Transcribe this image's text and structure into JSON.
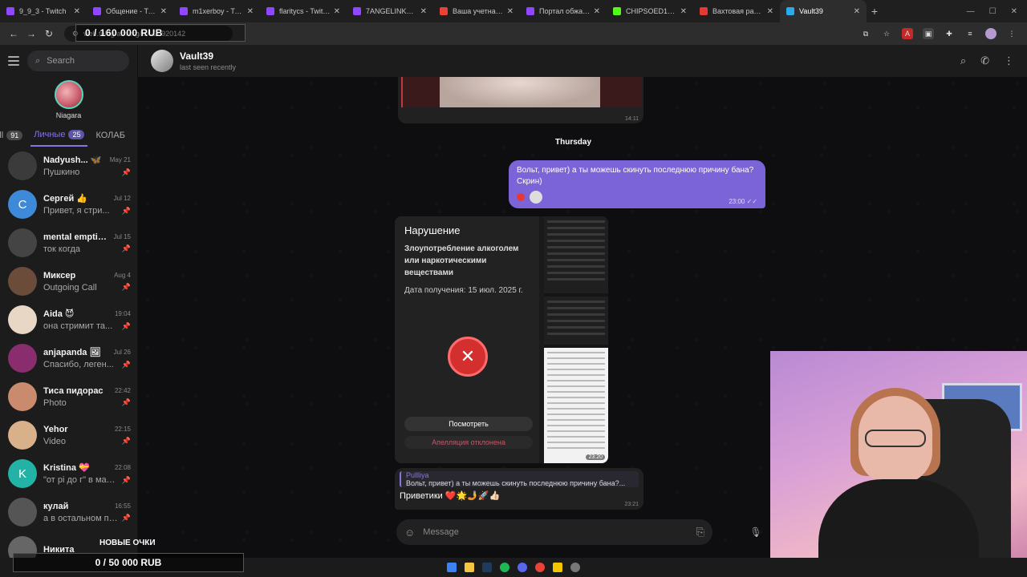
{
  "browser": {
    "tabs": [
      {
        "title": "9_9_3 - Twitch",
        "color": "#9146ff"
      },
      {
        "title": "Общение - Twitch",
        "color": "#9146ff"
      },
      {
        "title": "m1xerboy - Twitch",
        "color": "#9146ff"
      },
      {
        "title": "flaritycs - Twitch",
        "color": "#9146ff"
      },
      {
        "title": "7ANGELINKA - Twitch",
        "color": "#9146ff"
      },
      {
        "title": "Ваша учетная запись",
        "color": "#ea4335"
      },
      {
        "title": "Портал обжалования",
        "color": "#9146ff"
      },
      {
        "title": "CHIPSOED196 St...",
        "color": "#53fc18"
      },
      {
        "title": "Вахтовая работа",
        "color": "#e53935"
      },
      {
        "title": "Vault39",
        "color": "#2aabee"
      }
    ],
    "new_tab": "+",
    "address": "web.telegram.org/k/#-20920142"
  },
  "sidebar": {
    "search_placeholder": "Search",
    "profile_name": "Niagara",
    "folders": [
      {
        "label": "All",
        "count": "91"
      },
      {
        "label": "Личные",
        "count": "25"
      },
      {
        "label": "КОЛАБ",
        "count": ""
      }
    ],
    "chats": [
      {
        "name": "Nadyush...",
        "emoji": "🦋",
        "time": "May 21",
        "preview": "Пушкино",
        "avatar_color": "#3b3b3b",
        "initial": ""
      },
      {
        "name": "Сергей",
        "emoji": "👍",
        "time": "Jul 12",
        "preview": "Привет, я стри...",
        "avatar_color": "#3e8ad8",
        "initial": "C"
      },
      {
        "name": "mental emptin...",
        "emoji": "",
        "time": "Jul 15",
        "preview": "ток когда",
        "avatar_color": "#444",
        "initial": ""
      },
      {
        "name": "Миксер",
        "emoji": "",
        "time": "Aug 4",
        "preview": "Outgoing Call",
        "avatar_color": "#6b4b3a",
        "initial": ""
      },
      {
        "name": "Aida",
        "emoji": "😈",
        "time": "19:04",
        "preview": "она стримит та...",
        "avatar_color": "#e9d7c6",
        "initial": ""
      },
      {
        "name": "anjapanda",
        "emoji": "🖼",
        "time": "Jul 26",
        "preview": "Спасибо, леген...",
        "avatar_color": "#8a2d6e",
        "initial": ""
      },
      {
        "name": "Тиса пидорас",
        "emoji": "",
        "time": "22:42",
        "preview": "Photo",
        "avatar_color": "#c98a6e",
        "initial": ""
      },
      {
        "name": "Yehor",
        "emoji": "",
        "time": "22:15",
        "preview": "Video",
        "avatar_color": "#d8b08a",
        "initial": ""
      },
      {
        "name": "Kristina",
        "emoji": "💝",
        "time": "22:08",
        "preview": "\"от рі до г\" в матем...",
        "avatar_color": "#22b3a6",
        "initial": "K"
      },
      {
        "name": "кулай",
        "emoji": "",
        "time": "16:55",
        "preview": "а в остальном про...",
        "avatar_color": "#555",
        "initial": ""
      },
      {
        "name": "Никита",
        "emoji": "",
        "time": "",
        "preview": "",
        "avatar_color": "#666",
        "initial": ""
      }
    ]
  },
  "chat": {
    "name": "Vault39",
    "status": "last seen recently",
    "image_time": "14:11",
    "day": "Thursday",
    "outgoing": {
      "text": "Вольт, привет) а ты можешь скинуть последнюю причину бана? Скрин)",
      "time": "23:00"
    },
    "screenshot": {
      "title": "Нарушение",
      "reason": "Злоупотребление алкоголем или наркотическими веществами",
      "date": "Дата получения: 15 июл. 2025 г.",
      "view_button": "Посмотреть",
      "appeal_status": "Апелляция отклонена",
      "time": "23:20"
    },
    "incoming": {
      "quote_name": "Pullliya",
      "quote_text": "Вольт, привет) а ты можешь скинуть последнюю причину бана?...",
      "text": "Приветики ❤️🌟🤳🚀👍🏻",
      "time": "23:21"
    },
    "composer_placeholder": "Message"
  },
  "overlays": {
    "goal_top": "0 / 160 000 RUB",
    "goal_label": "НОВЫЕ ОЧКИ",
    "goal_bottom": "0 / 50 000 RUB"
  },
  "colors": {
    "accent": "#8774e1",
    "outgoing_bubble": "#7b64d8",
    "danger": "#d32f2f"
  }
}
